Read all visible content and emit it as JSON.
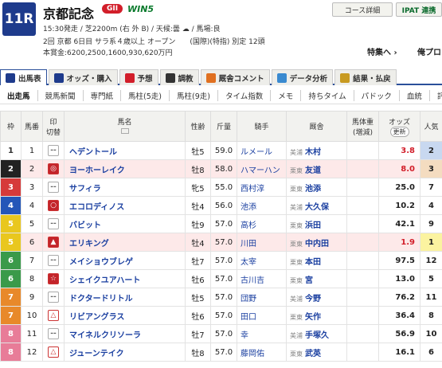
{
  "race": {
    "number": "11R",
    "name": "京都記念",
    "grade": "GII",
    "win5": "WIN5",
    "line1": "15:30発走 / 芝2200m (右 外 B) / 天候:曇 ☁ / 馬場:良",
    "line2": "2回 京都 6日目 サラ系４歳以上 オープン　　(国際)(特指) 別定 12頭",
    "line3": "本賞金:6200,2500,1600,930,620万円"
  },
  "header_buttons": {
    "course": "コース詳細",
    "ipat": "IPAT 連携",
    "tokusen": "特集へ ›",
    "orekara": "俺プロ"
  },
  "tabs": [
    {
      "label": "出馬表",
      "color": "#1e3b8c"
    },
    {
      "label": "オッズ・購入",
      "color": "#1e3b8c"
    },
    {
      "label": "予想",
      "color": "#d21e2a"
    },
    {
      "label": "調教",
      "color": "#333333"
    },
    {
      "label": "厩舎コメント",
      "color": "#e07020"
    },
    {
      "label": "データ分析",
      "color": "#3a8ad0"
    },
    {
      "label": "結果・払戻",
      "color": "#c89a20"
    }
  ],
  "subtabs": [
    "出走馬",
    "競馬新聞",
    "専門紙",
    "馬柱(5走)",
    "馬柱(9走)",
    "タイム指数",
    "メモ",
    "持ちタイム",
    "パドック",
    "血統",
    "評価"
  ],
  "table": {
    "headers": {
      "waku": "枠",
      "umaban": "馬番",
      "shirushi": "印",
      "kirikae": "切替",
      "horse": "馬名",
      "seirei": "性齢",
      "kinryo": "斤量",
      "jockey": "騎手",
      "trainer": "厩舎",
      "weight": "馬体重(増減)",
      "odds": "オッズ",
      "update": "更新",
      "pop": "人気"
    },
    "rows": [
      {
        "waku": "1",
        "umaban": "1",
        "mark": "--",
        "horse": "ヘデントール",
        "seirei": "牡5",
        "kinryo": "59.0",
        "jockey": "ルメール",
        "area": "美浦",
        "trainer": "木村",
        "odds": "3.8",
        "pop": "2",
        "wcolor": "#ffffff",
        "wtext": "#333333",
        "hi": false,
        "red": true
      },
      {
        "waku": "2",
        "umaban": "2",
        "mark": "◎",
        "horse": "ヨーホーレイク",
        "seirei": "牡8",
        "kinryo": "58.0",
        "jockey": "ハマーハン",
        "area": "栗東",
        "trainer": "友道",
        "odds": "8.0",
        "pop": "3",
        "wcolor": "#222222",
        "wtext": "#ffffff",
        "hi": true,
        "red": true
      },
      {
        "waku": "3",
        "umaban": "3",
        "mark": "--",
        "horse": "サフィラ",
        "seirei": "牝5",
        "kinryo": "55.0",
        "jockey": "西村淳",
        "area": "栗東",
        "trainer": "池添",
        "odds": "25.0",
        "pop": "7",
        "wcolor": "#d63a3a",
        "wtext": "#ffffff",
        "hi": false,
        "red": false
      },
      {
        "waku": "4",
        "umaban": "4",
        "mark": "○",
        "horse": "エコロディノス",
        "seirei": "牡4",
        "kinryo": "56.0",
        "jockey": "池添",
        "area": "美浦",
        "trainer": "大久保",
        "odds": "10.2",
        "pop": "4",
        "wcolor": "#2456b8",
        "wtext": "#ffffff",
        "hi": false,
        "red": false
      },
      {
        "waku": "5",
        "umaban": "5",
        "mark": "--",
        "horse": "バビット",
        "seirei": "牡9",
        "kinryo": "57.0",
        "jockey": "高杉",
        "area": "栗東",
        "trainer": "浜田",
        "odds": "42.1",
        "pop": "9",
        "wcolor": "#e9c71e",
        "wtext": "#ffffff",
        "hi": false,
        "red": false
      },
      {
        "waku": "5",
        "umaban": "6",
        "mark": "▲",
        "horse": "エリキング",
        "seirei": "牡4",
        "kinryo": "57.0",
        "jockey": "川田",
        "area": "栗東",
        "trainer": "中内田",
        "odds": "1.9",
        "pop": "1",
        "wcolor": "#e9c71e",
        "wtext": "#ffffff",
        "hi": true,
        "red": true
      },
      {
        "waku": "6",
        "umaban": "7",
        "mark": "--",
        "horse": "メイショウブレゲ",
        "seirei": "牡7",
        "kinryo": "57.0",
        "jockey": "太宰",
        "area": "栗東",
        "trainer": "本田",
        "odds": "97.5",
        "pop": "12",
        "wcolor": "#3a9a4a",
        "wtext": "#ffffff",
        "hi": false,
        "red": false
      },
      {
        "waku": "6",
        "umaban": "8",
        "mark": "☆",
        "horse": "シェイクユアハート",
        "seirei": "牡6",
        "kinryo": "57.0",
        "jockey": "古川吉",
        "area": "栗東",
        "trainer": "宮",
        "odds": "13.0",
        "pop": "5",
        "wcolor": "#3a9a4a",
        "wtext": "#ffffff",
        "hi": false,
        "red": false
      },
      {
        "waku": "7",
        "umaban": "9",
        "mark": "--",
        "horse": "ドクタードリトル",
        "seirei": "牡5",
        "kinryo": "57.0",
        "jockey": "団野",
        "area": "美浦",
        "trainer": "今野",
        "odds": "76.2",
        "pop": "11",
        "wcolor": "#e8892a",
        "wtext": "#ffffff",
        "hi": false,
        "red": false
      },
      {
        "waku": "7",
        "umaban": "10",
        "mark": "△",
        "horse": "リビアングラス",
        "seirei": "牡6",
        "kinryo": "57.0",
        "jockey": "田口",
        "area": "栗東",
        "trainer": "矢作",
        "odds": "36.4",
        "pop": "8",
        "wcolor": "#e8892a",
        "wtext": "#ffffff",
        "hi": false,
        "red": false
      },
      {
        "waku": "8",
        "umaban": "11",
        "mark": "--",
        "horse": "マイネルクリソーラ",
        "seirei": "牡7",
        "kinryo": "57.0",
        "jockey": "幸",
        "area": "美浦",
        "trainer": "手塚久",
        "odds": "56.9",
        "pop": "10",
        "wcolor": "#e87c98",
        "wtext": "#ffffff",
        "hi": false,
        "red": false
      },
      {
        "waku": "8",
        "umaban": "12",
        "mark": "△",
        "horse": "ジューンテイク",
        "seirei": "牡8",
        "kinryo": "57.0",
        "jockey": "藤岡佑",
        "area": "栗東",
        "trainer": "武英",
        "odds": "16.1",
        "pop": "6",
        "wcolor": "#e87c98",
        "wtext": "#ffffff",
        "hi": false,
        "red": false
      }
    ]
  }
}
